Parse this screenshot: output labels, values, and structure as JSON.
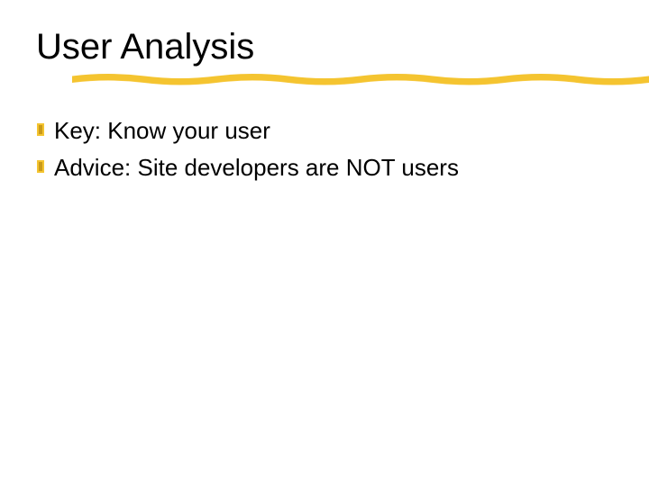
{
  "slide": {
    "title": "User Analysis",
    "bullets": [
      {
        "text": "Key: Know your user"
      },
      {
        "text": "Advice: Site developers are NOT users"
      }
    ]
  },
  "colors": {
    "accent": "#f4c430"
  }
}
